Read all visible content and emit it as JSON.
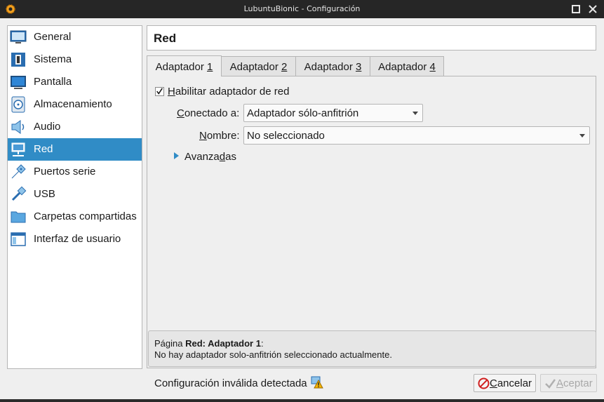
{
  "window": {
    "title": "LubuntuBionic - Configuración"
  },
  "sidebar": {
    "items": [
      {
        "label": "General",
        "icon": "monitor-icon"
      },
      {
        "label": "Sistema",
        "icon": "chip-icon"
      },
      {
        "label": "Pantalla",
        "icon": "display-icon"
      },
      {
        "label": "Almacenamiento",
        "icon": "disk-icon"
      },
      {
        "label": "Audio",
        "icon": "speaker-icon"
      },
      {
        "label": "Red",
        "icon": "network-icon",
        "selected": true
      },
      {
        "label": "Puertos serie",
        "icon": "serial-port-icon"
      },
      {
        "label": "USB",
        "icon": "usb-icon"
      },
      {
        "label": "Carpetas compartidas",
        "icon": "folder-icon"
      },
      {
        "label": "Interfaz de usuario",
        "icon": "window-icon"
      }
    ]
  },
  "page": {
    "title": "Red"
  },
  "tabs": [
    {
      "label": "Adaptador ",
      "mnemonic": "1",
      "active": true
    },
    {
      "label": "Adaptador ",
      "mnemonic": "2"
    },
    {
      "label": "Adaptador ",
      "mnemonic": "3"
    },
    {
      "label": "Adaptador ",
      "mnemonic": "4"
    }
  ],
  "adapter": {
    "enable_label_mnemonic": "H",
    "enable_label_rest": "abilitar adaptador de red",
    "enabled": true,
    "attached_label_mnemonic": "C",
    "attached_label_rest": "onectado a:",
    "attached_value": "Adaptador sólo-anfitrión",
    "name_label_mnemonic": "N",
    "name_label_rest": "ombre:",
    "name_value": "No seleccionado",
    "advanced_label_a": "Avanza",
    "advanced_label_mnemonic": "d",
    "advanced_label_b": "as"
  },
  "info": {
    "prefix": "Página ",
    "bold": "Red: Adaptador 1",
    "suffix": ":",
    "message": "No hay adaptador solo-anfitrión seleccionado actualmente."
  },
  "footer": {
    "status": "Configuración inválida detectada",
    "cancel_mnemonic": "C",
    "cancel_rest": "ancelar",
    "accept_mnemonic": "A",
    "accept_rest": "ceptar"
  },
  "colors": {
    "accent": "#308cc6",
    "window_bg": "#efefef",
    "titlebar": "#262626"
  }
}
